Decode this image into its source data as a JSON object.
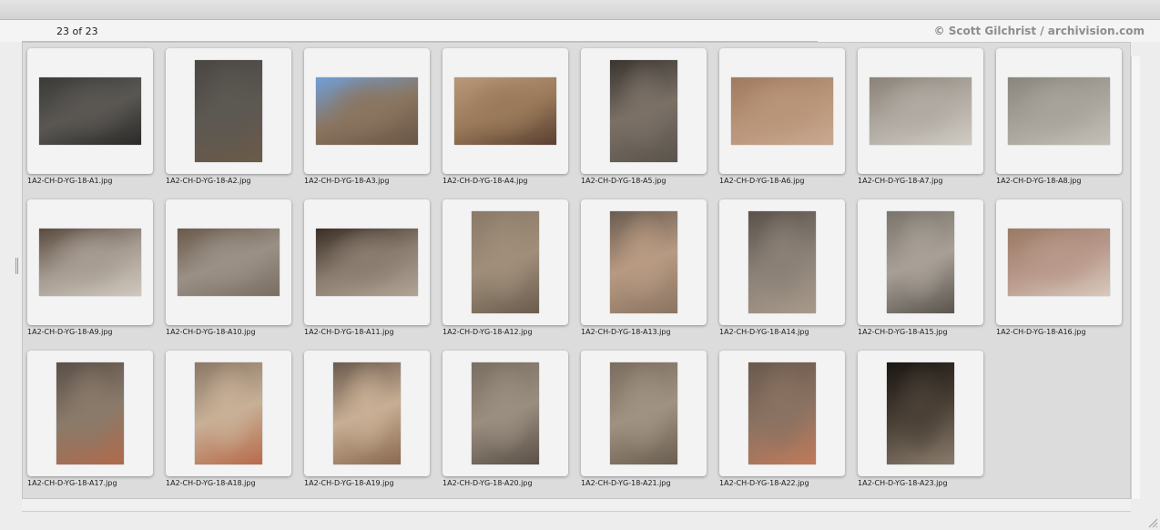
{
  "header": {
    "count_text": "23 of 23",
    "copyright": "© Scott Gilchrist / archivision.com"
  },
  "thumbnails": [
    {
      "filename": "1A2-CH-D-YG-18-A1.jpg",
      "orientation": "landscape",
      "colors": [
        "#3a3a38",
        "#5a5753",
        "#2a2a28"
      ]
    },
    {
      "filename": "1A2-CH-D-YG-18-A2.jpg",
      "orientation": "portrait",
      "colors": [
        "#4a4642",
        "#5c5852",
        "#6b5a48"
      ]
    },
    {
      "filename": "1A2-CH-D-YG-18-A3.jpg",
      "orientation": "landscape",
      "colors": [
        "#6f9fd8",
        "#8a7560",
        "#6a5645"
      ]
    },
    {
      "filename": "1A2-CH-D-YG-18-A4.jpg",
      "orientation": "landscape",
      "colors": [
        "#b89878",
        "#9a7a5a",
        "#5a4030"
      ]
    },
    {
      "filename": "1A2-CH-D-YG-18-A5.jpg",
      "orientation": "portrait",
      "colors": [
        "#3a3530",
        "#7a7066",
        "#5a544c"
      ]
    },
    {
      "filename": "1A2-CH-D-YG-18-A6.jpg",
      "orientation": "landscape",
      "colors": [
        "#a07a60",
        "#b89478",
        "#c8a890"
      ]
    },
    {
      "filename": "1A2-CH-D-YG-18-A7.jpg",
      "orientation": "landscape",
      "colors": [
        "#8a8278",
        "#b0aaa2",
        "#cfcac2"
      ]
    },
    {
      "filename": "1A2-CH-D-YG-18-A8.jpg",
      "orientation": "landscape",
      "colors": [
        "#8a857e",
        "#a8a39a",
        "#c4bfb6"
      ]
    },
    {
      "filename": "1A2-CH-D-YG-18-A9.jpg",
      "orientation": "landscape",
      "colors": [
        "#5a4a3e",
        "#a69c92",
        "#d0c8be"
      ]
    },
    {
      "filename": "1A2-CH-D-YG-18-A10.jpg",
      "orientation": "landscape",
      "colors": [
        "#6a5a4a",
        "#9a9086",
        "#7a6e62"
      ]
    },
    {
      "filename": "1A2-CH-D-YG-18-A11.jpg",
      "orientation": "landscape",
      "colors": [
        "#3a2e26",
        "#8a7c6e",
        "#b0a496"
      ]
    },
    {
      "filename": "1A2-CH-D-YG-18-A12.jpg",
      "orientation": "portrait",
      "colors": [
        "#8a7a68",
        "#a08e7a",
        "#6a5c4e"
      ]
    },
    {
      "filename": "1A2-CH-D-YG-18-A13.jpg",
      "orientation": "portrait",
      "colors": [
        "#6a5c50",
        "#b89a82",
        "#8a7462"
      ]
    },
    {
      "filename": "1A2-CH-D-YG-18-A14.jpg",
      "orientation": "portrait",
      "colors": [
        "#5a524a",
        "#8a8076",
        "#a89a8a"
      ]
    },
    {
      "filename": "1A2-CH-D-YG-18-A15.jpg",
      "orientation": "portrait",
      "colors": [
        "#7a746c",
        "#a8a096",
        "#5a544e"
      ]
    },
    {
      "filename": "1A2-CH-D-YG-18-A16.jpg",
      "orientation": "landscape",
      "colors": [
        "#9a7a64",
        "#b8988a",
        "#d8c8bc"
      ]
    },
    {
      "filename": "1A2-CH-D-YG-18-A17.jpg",
      "orientation": "portrait",
      "colors": [
        "#5a5048",
        "#8a7a6a",
        "#b06a4a"
      ]
    },
    {
      "filename": "1A2-CH-D-YG-18-A18.jpg",
      "orientation": "portrait",
      "colors": [
        "#8a7866",
        "#c8b096",
        "#b86a4a"
      ]
    },
    {
      "filename": "1A2-CH-D-YG-18-A19.jpg",
      "orientation": "portrait",
      "colors": [
        "#6a5a4c",
        "#c8ae94",
        "#8a6a50"
      ]
    },
    {
      "filename": "1A2-CH-D-YG-18-A20.jpg",
      "orientation": "portrait",
      "colors": [
        "#7a6e62",
        "#9a8e80",
        "#5a5046"
      ]
    },
    {
      "filename": "1A2-CH-D-YG-18-A21.jpg",
      "orientation": "portrait",
      "colors": [
        "#7a6c5e",
        "#a09282",
        "#6a5e50"
      ]
    },
    {
      "filename": "1A2-CH-D-YG-18-A22.jpg",
      "orientation": "portrait",
      "colors": [
        "#6a5a4c",
        "#8a7262",
        "#c07a5a"
      ]
    },
    {
      "filename": "1A2-CH-D-YG-18-A23.jpg",
      "orientation": "portrait",
      "colors": [
        "#1a1612",
        "#4a4036",
        "#8a7c6c"
      ]
    }
  ]
}
